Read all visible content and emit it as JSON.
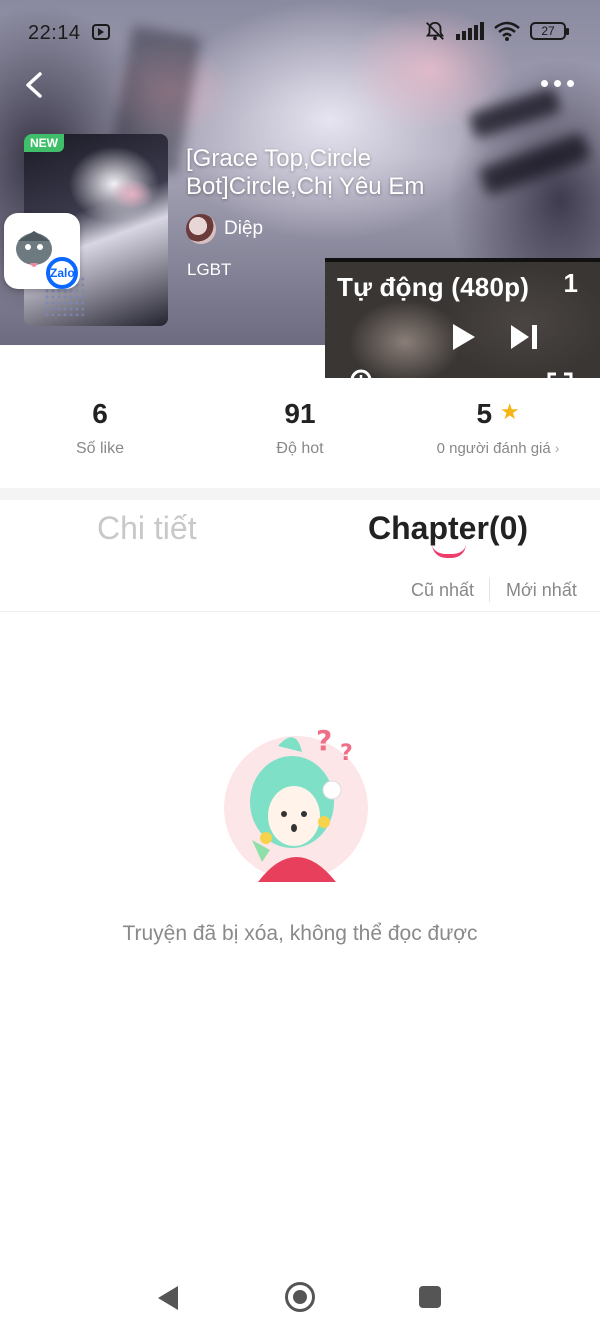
{
  "status_bar": {
    "time": "22:14",
    "battery": "27"
  },
  "comic": {
    "cover_badge": "NEW",
    "title": "[Grace Top,Circle Bot]Circle,Chị Yêu Em",
    "author": "Diệp",
    "genre": "LGBT"
  },
  "overlay": {
    "app_name": "Zalo"
  },
  "player": {
    "quality": "Tự động (480p)",
    "count": "1",
    "progress": 0.05
  },
  "stats": [
    {
      "value": "6",
      "label": "Số like"
    },
    {
      "value": "91",
      "label": "Độ hot"
    },
    {
      "value": "5",
      "label": "0 người đánh giá"
    }
  ],
  "tabs": {
    "detail": "Chi tiết",
    "chapter": "Chapter(0)"
  },
  "sort": {
    "oldest": "Cũ nhất",
    "newest": "Mới nhất"
  },
  "empty_state": {
    "message": "Truyện đã bị xóa, không thể đọc được"
  },
  "colors": {
    "accent": "#ec3d6b",
    "progress": "#1fd35b",
    "star": "#f6b516"
  }
}
